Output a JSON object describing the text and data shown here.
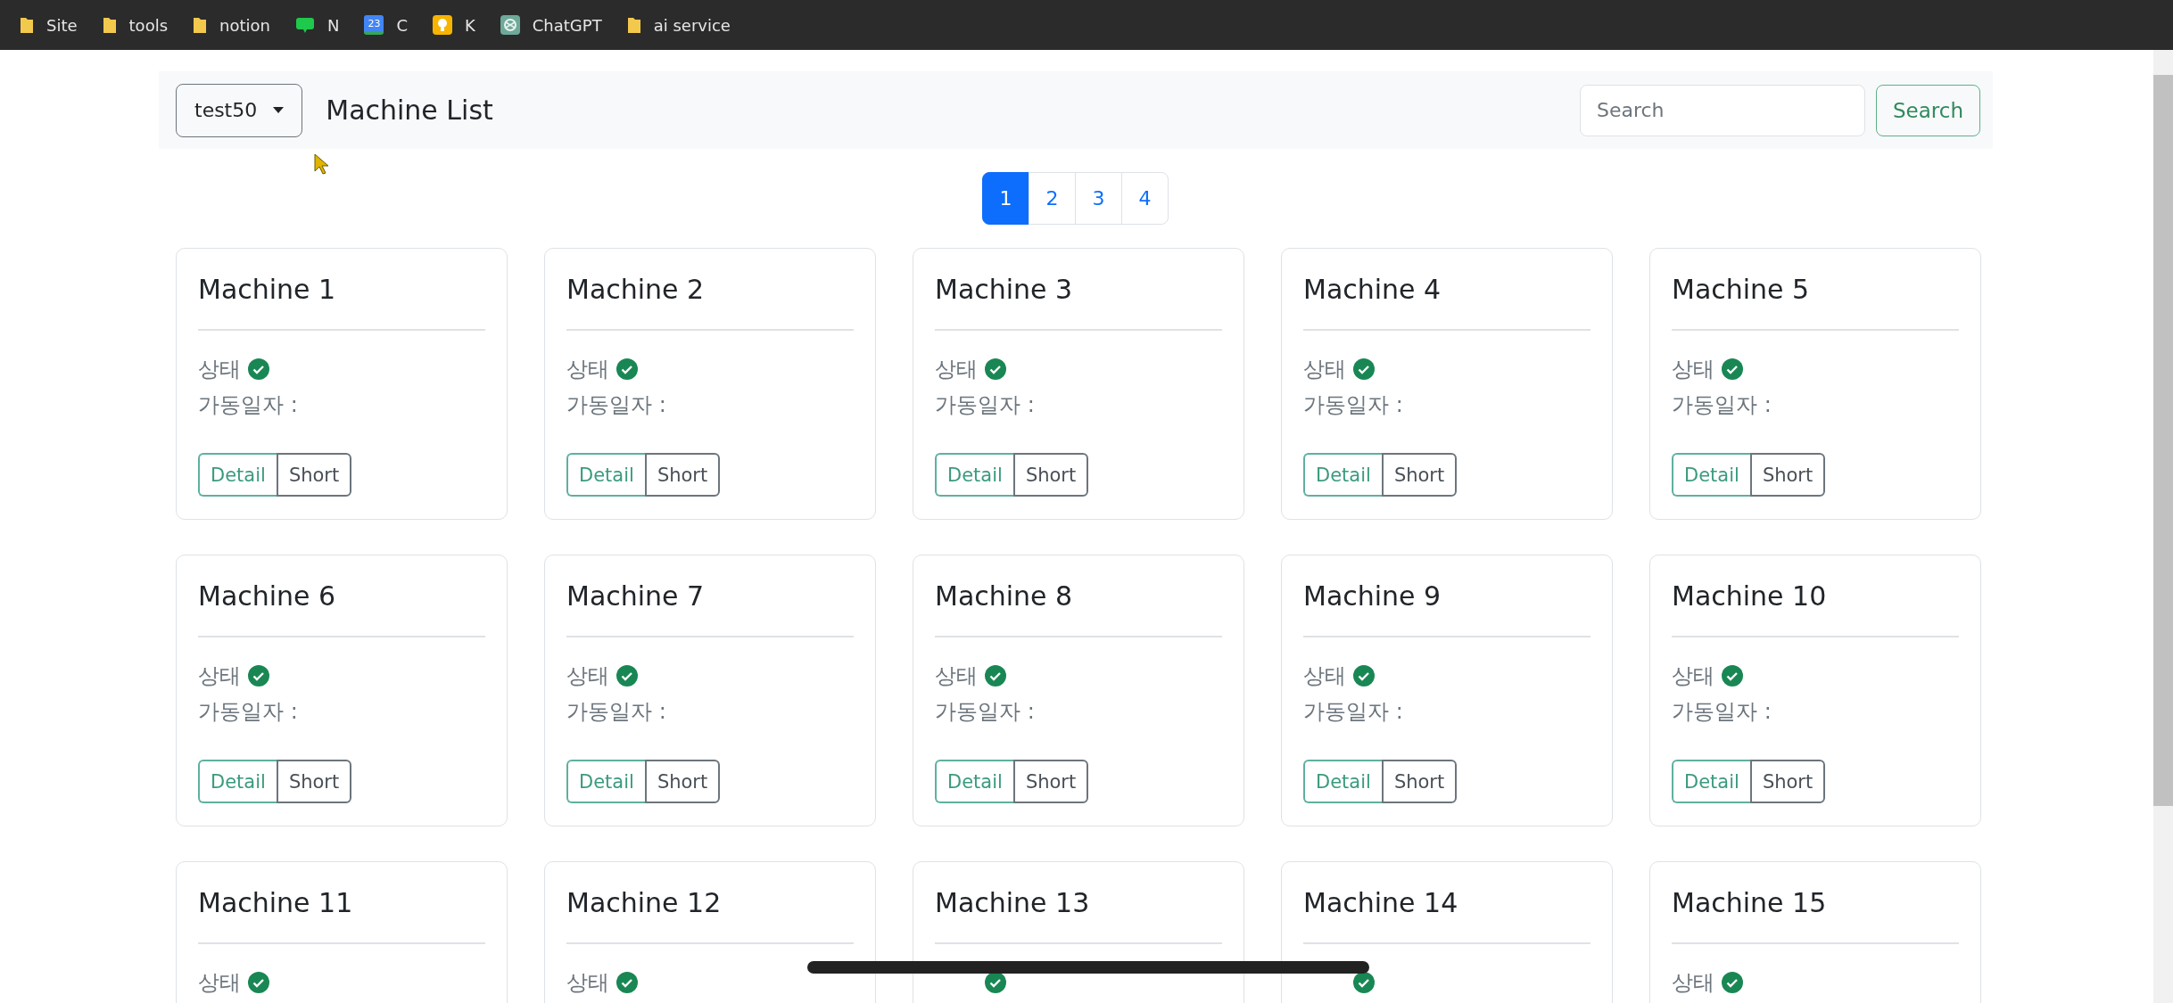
{
  "bookmarks": [
    {
      "kind": "folder",
      "label": "Site"
    },
    {
      "kind": "folder",
      "label": "tools"
    },
    {
      "kind": "folder",
      "label": "notion"
    },
    {
      "kind": "chat",
      "label": "N"
    },
    {
      "kind": "calendar",
      "label": "C",
      "icon_text": "23"
    },
    {
      "kind": "bulb",
      "label": "K"
    },
    {
      "kind": "knot",
      "label": "ChatGPT"
    },
    {
      "kind": "folder",
      "label": "ai service"
    }
  ],
  "header": {
    "dropdown": "test50",
    "title": "Machine List",
    "search": {
      "placeholder": "Search"
    },
    "search_button": "Search"
  },
  "pagination": [
    {
      "label": "1",
      "selected": true
    },
    {
      "label": "2",
      "selected": false
    },
    {
      "label": "3",
      "selected": false
    },
    {
      "label": "4",
      "selected": false
    }
  ],
  "cards": [
    {
      "title": "Machine 1",
      "status_label": "상태",
      "status_ok": true,
      "date_label": "가동일자 :",
      "buttons": [
        "Detail",
        "Short"
      ]
    },
    {
      "title": "Machine 2",
      "status_label": "상태",
      "status_ok": true,
      "date_label": "가동일자 :",
      "buttons": [
        "Detail",
        "Short"
      ]
    },
    {
      "title": "Machine 3",
      "status_label": "상태",
      "status_ok": true,
      "date_label": "가동일자 :",
      "buttons": [
        "Detail",
        "Short"
      ]
    },
    {
      "title": "Machine 4",
      "status_label": "상태",
      "status_ok": true,
      "date_label": "가동일자 :",
      "buttons": [
        "Detail",
        "Short"
      ]
    },
    {
      "title": "Machine 5",
      "status_label": "상태",
      "status_ok": true,
      "date_label": "가동일자 :",
      "buttons": [
        "Detail",
        "Short"
      ]
    },
    {
      "title": "Machine 6",
      "status_label": "상태",
      "status_ok": true,
      "date_label": "가동일자 :",
      "buttons": [
        "Detail",
        "Short"
      ]
    },
    {
      "title": "Machine 7",
      "status_label": "상태",
      "status_ok": true,
      "date_label": "가동일자 :",
      "buttons": [
        "Detail",
        "Short"
      ]
    },
    {
      "title": "Machine 8",
      "status_label": "상태",
      "status_ok": true,
      "date_label": "가동일자 :",
      "buttons": [
        "Detail",
        "Short"
      ]
    },
    {
      "title": "Machine 9",
      "status_label": "상태",
      "status_ok": true,
      "date_label": "가동일자 :",
      "buttons": [
        "Detail",
        "Short"
      ]
    },
    {
      "title": "Machine 10",
      "status_label": "상태",
      "status_ok": true,
      "date_label": "가동일자 :",
      "buttons": [
        "Detail",
        "Short"
      ]
    },
    {
      "title": "Machine 11",
      "status_label": "상태",
      "status_ok": true
    },
    {
      "title": "Machine 12",
      "status_label": "상태",
      "status_ok": true
    },
    {
      "title": "Machine 13",
      "status_ok": true
    },
    {
      "title": "Machine 14",
      "status_ok": true
    },
    {
      "title": "Machine 15",
      "status_label": "상태",
      "status_ok": true
    }
  ]
}
